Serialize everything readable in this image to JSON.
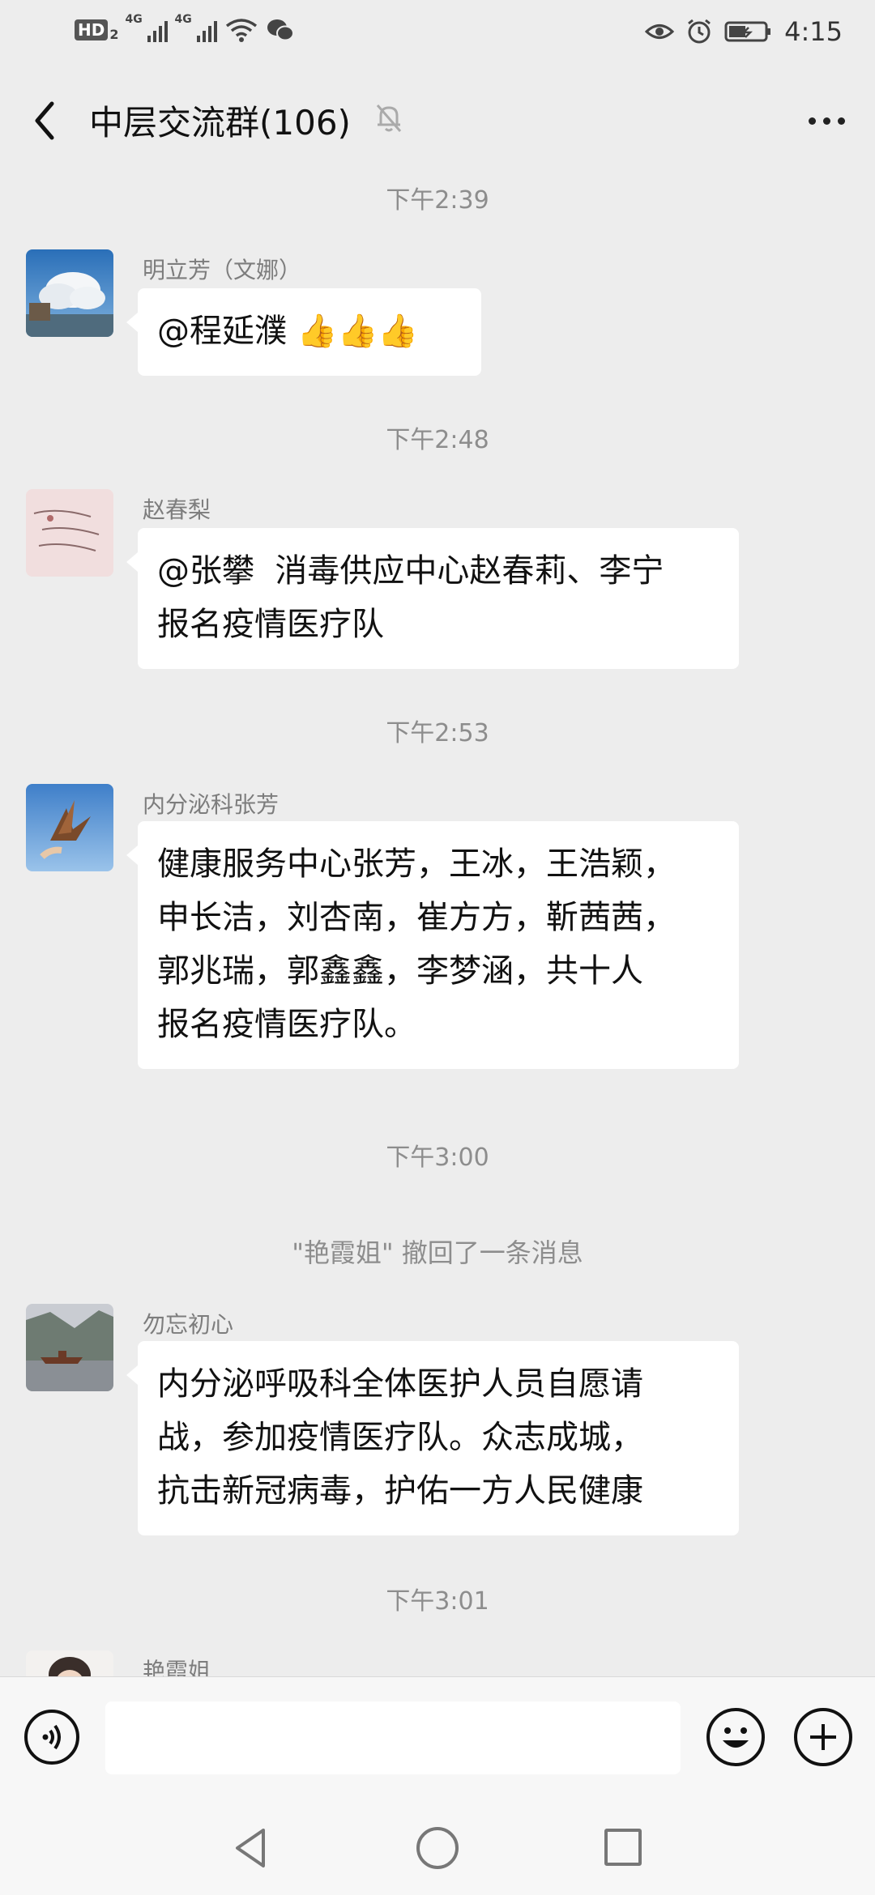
{
  "status_bar": {
    "hd_label": "HD",
    "hd_sub": "2",
    "signal1_label": "4G",
    "signal2_label": "4G",
    "time": "4:15"
  },
  "header": {
    "title": "中层交流群(106)"
  },
  "messages": [
    {
      "type": "time",
      "text": "下午2:39"
    },
    {
      "type": "msg",
      "sender": "明立芳（文娜）",
      "text": "@程延濮 👍👍👍"
    },
    {
      "type": "time",
      "text": "下午2:48"
    },
    {
      "type": "msg",
      "sender": "赵春梨",
      "text": "@张攀  消毒供应中心赵春莉、李宁\n报名疫情医疗队"
    },
    {
      "type": "time",
      "text": "下午2:53"
    },
    {
      "type": "msg",
      "sender": "内分泌科张芳",
      "text": "健康服务中心张芳，王冰，王浩颖，\n申长洁，刘杏南，崔方方，靳茜茜，\n郭兆瑞，郭鑫鑫，李梦涵，共十人\n报名疫情医疗队。"
    },
    {
      "type": "time",
      "text": "下午3:00"
    },
    {
      "type": "system",
      "text": "\"艳霞姐\" 撤回了一条消息"
    },
    {
      "type": "msg",
      "sender": "勿忘初心",
      "text": "内分泌呼吸科全体医护人员自愿请\n战，参加疫情医疗队。众志成城，\n抗击新冠病毒，护佑一方人民健康"
    },
    {
      "type": "time",
      "text": "下午3:01"
    },
    {
      "type": "msg",
      "sender": "艳霞姐",
      "text": ""
    }
  ],
  "input": {
    "text": ""
  },
  "colors": {
    "background": "#ededed",
    "bubble": "#ffffff",
    "timestamp": "#8d8d8d"
  },
  "icons": [
    "back-arrow-icon",
    "mute-bell-icon",
    "more-dots-icon",
    "voice-icon",
    "emoji-icon",
    "plus-icon",
    "nav-back-icon",
    "nav-home-icon",
    "nav-recent-icon"
  ]
}
